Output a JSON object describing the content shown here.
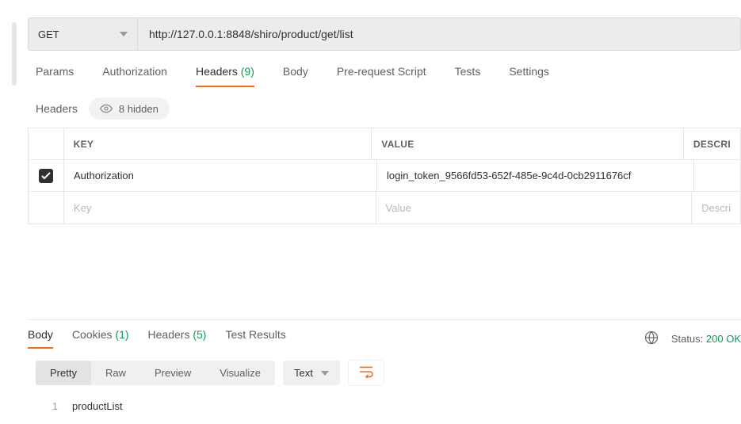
{
  "request": {
    "method": "GET",
    "url": "http://127.0.0.1:8848/shiro/product/get/list"
  },
  "tabs": {
    "params": "Params",
    "authorization": "Authorization",
    "headers_label": "Headers",
    "headers_count": "(9)",
    "body": "Body",
    "prerequest": "Pre-request Script",
    "tests": "Tests",
    "settings": "Settings"
  },
  "headers_section": {
    "title": "Headers",
    "hidden_label": "8 hidden",
    "columns": {
      "key": "KEY",
      "value": "VALUE",
      "desc": "DESCRI"
    },
    "row": {
      "key": "Authorization",
      "value": "login_token_9566fd53-652f-485e-9c4d-0cb2911676cf"
    },
    "placeholders": {
      "key": "Key",
      "value": "Value",
      "desc": "Descri"
    }
  },
  "response": {
    "tabs": {
      "body": "Body",
      "cookies_label": "Cookies",
      "cookies_count": "(1)",
      "headers_label": "Headers",
      "headers_count": "(5)",
      "test_results": "Test Results"
    },
    "status_label": "Status:",
    "status_value": "200 OK",
    "view": {
      "pretty": "Pretty",
      "raw": "Raw",
      "preview": "Preview",
      "visualize": "Visualize",
      "format": "Text"
    },
    "body_lines": {
      "1": "productList"
    }
  }
}
